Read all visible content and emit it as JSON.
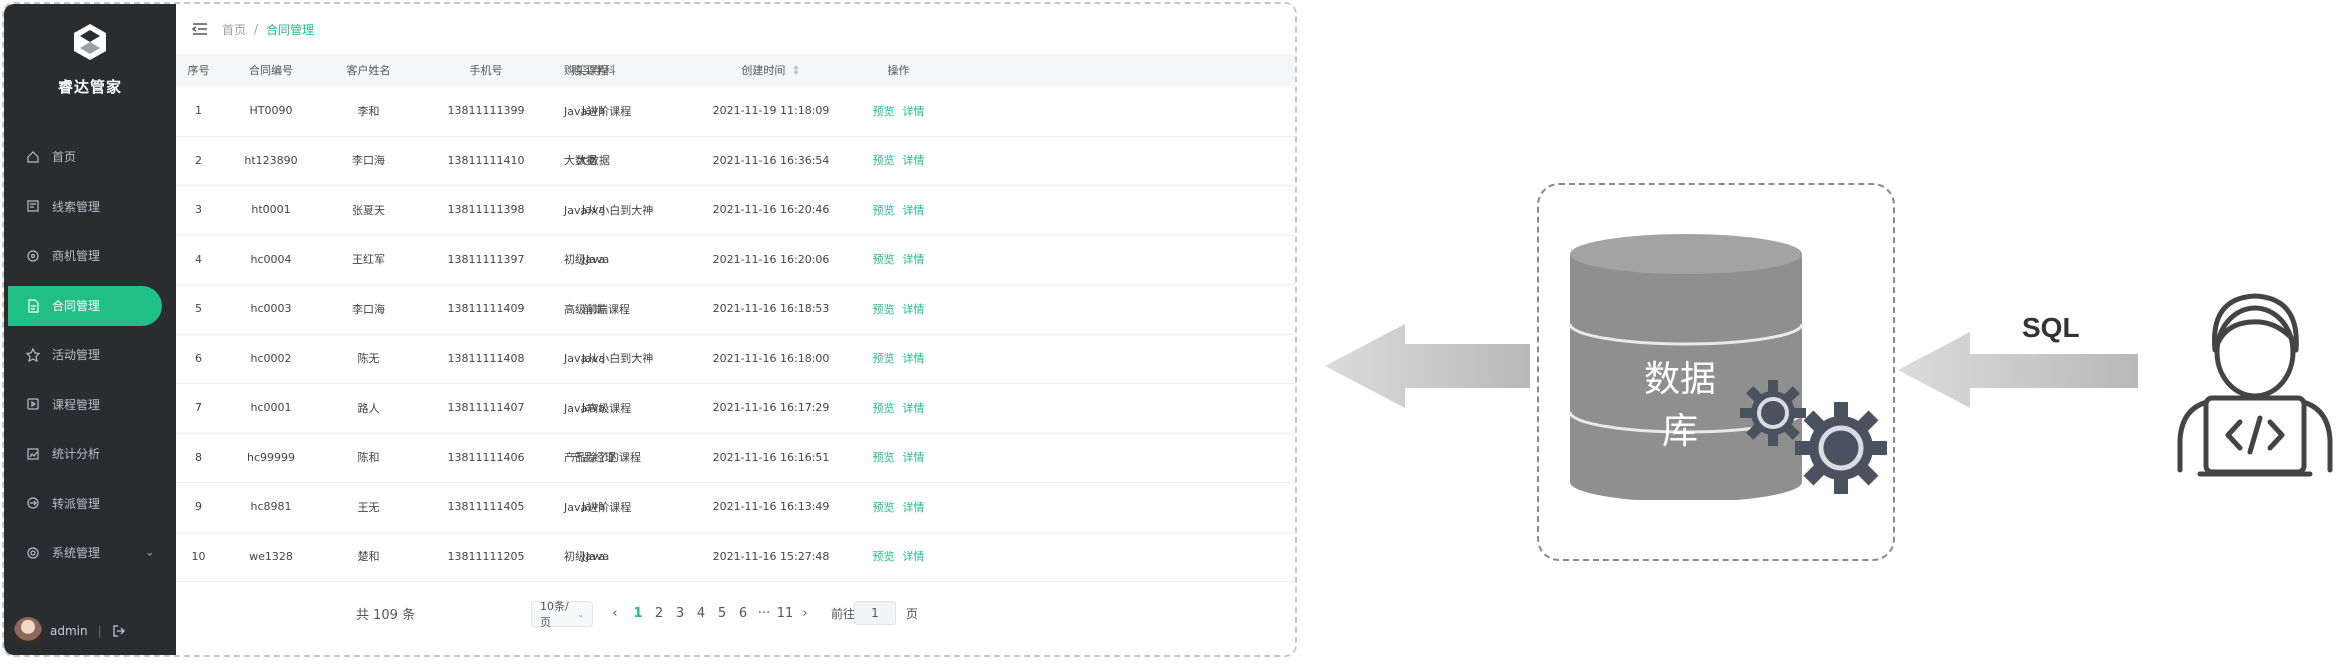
{
  "app": {
    "name": "睿达管家",
    "breadcrumb": [
      "首页",
      "合同管理"
    ],
    "user": "admin"
  },
  "sidebar": {
    "items": [
      {
        "label": "首页",
        "icon": "home-icon"
      },
      {
        "label": "线索管理",
        "icon": "clue-icon"
      },
      {
        "label": "商机管理",
        "icon": "opportunity-icon"
      },
      {
        "label": "合同管理",
        "icon": "contract-icon",
        "active": true
      },
      {
        "label": "活动管理",
        "icon": "activity-icon"
      },
      {
        "label": "课程管理",
        "icon": "course-icon"
      },
      {
        "label": "统计分析",
        "icon": "chart-icon"
      },
      {
        "label": "转派管理",
        "icon": "transfer-icon"
      },
      {
        "label": "系统管理",
        "icon": "settings-icon",
        "expandable": true
      }
    ]
  },
  "table": {
    "columns": [
      "序号",
      "合同编号",
      "客户姓名",
      "手机号",
      "购买学科",
      "购买课程",
      "创建时间",
      "操作"
    ],
    "sort_icon": "⇕",
    "actions": [
      "预览",
      "详情"
    ],
    "rows": [
      [
        "1",
        "HT0090",
        "李和",
        "13811111399",
        "Java",
        "Java进阶课程",
        "2021-11-19 11:18:09"
      ],
      [
        "2",
        "ht123890",
        "李口海",
        "13811111410",
        "大数据",
        "大数据",
        "2021-11-16 16:36:54"
      ],
      [
        "3",
        "ht0001",
        "张夏天",
        "13811111398",
        "Java",
        "Java从小白到大神",
        "2021-11-16 16:20:46"
      ],
      [
        "4",
        "hc0004",
        "王红军",
        "13811111397",
        "Java",
        "初级Java",
        "2021-11-16 16:20:06"
      ],
      [
        "5",
        "hc0003",
        "李口海",
        "13811111409",
        "前端",
        "高级前端课程",
        "2021-11-16 16:18:53"
      ],
      [
        "6",
        "hc0002",
        "陈无",
        "13811111408",
        "Java",
        "Java从小白到大神",
        "2021-11-16 16:18:00"
      ],
      [
        "7",
        "hc0001",
        "路人",
        "13811111407",
        "Java",
        "Java高级课程",
        "2021-11-16 16:17:29"
      ],
      [
        "8",
        "hc99999",
        "陈和",
        "13811111406",
        "产品经理",
        "产品除了的课程",
        "2021-11-16 16:16:51"
      ],
      [
        "9",
        "hc8981",
        "王无",
        "13811111405",
        "Java",
        "Java进阶课程",
        "2021-11-16 16:13:49"
      ],
      [
        "10",
        "we1328",
        "楚和",
        "13811111205",
        "Java",
        "初级Java",
        "2021-11-16 15:27:48"
      ]
    ]
  },
  "pager": {
    "total": "共 109 条",
    "page_size": "10条/页",
    "prev": "‹",
    "pages": [
      "1",
      "2",
      "3",
      "4",
      "5",
      "6",
      "···",
      "11"
    ],
    "next": "›",
    "goto_label": "前往",
    "goto_value": "1",
    "goto_suffix": "页"
  },
  "diagram": {
    "database_label": "数据库",
    "query_label": "SQL",
    "colors": {
      "arrow": "#c9c9c9",
      "db": "#8f8f8f",
      "gear": "#4a5260",
      "accent": "#1fbf86"
    }
  }
}
